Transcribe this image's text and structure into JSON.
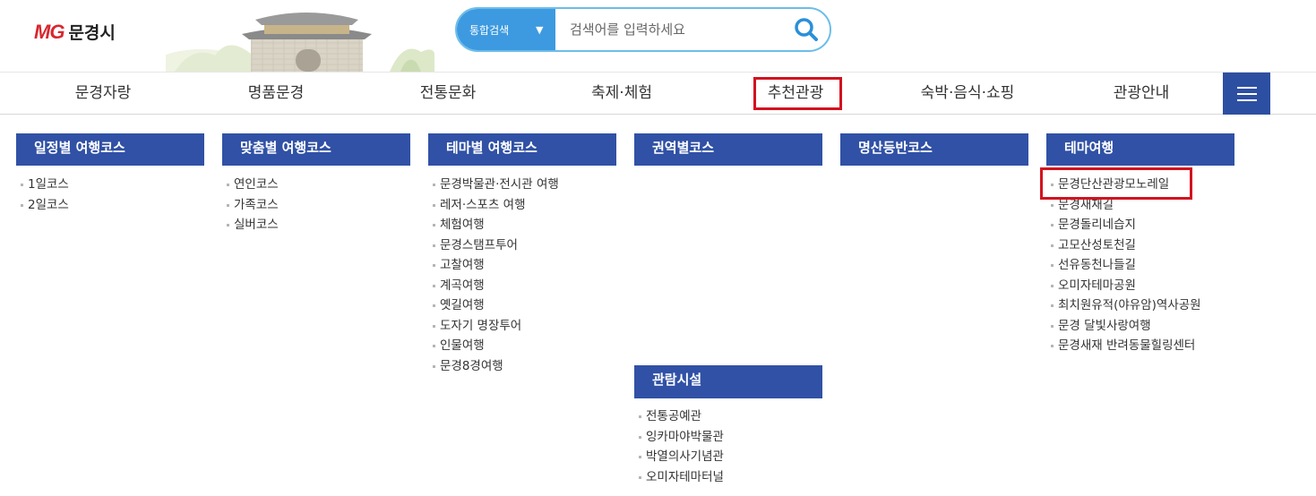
{
  "header": {
    "logo_mark": "MG",
    "logo_text": "문경시",
    "search": {
      "category": "통합검색",
      "placeholder": "검색어를 입력하세요"
    }
  },
  "gnb": {
    "items": [
      "문경자랑",
      "명품문경",
      "전통문화",
      "축제·체험",
      "추천관광",
      "숙박·음식·쇼핑",
      "관광안내"
    ],
    "active": "추천관광"
  },
  "submenu": {
    "col1": {
      "title": "일정별 여행코스",
      "items": [
        "1일코스",
        "2일코스"
      ]
    },
    "col2": {
      "title": "맞춤별 여행코스",
      "items": [
        "연인코스",
        "가족코스",
        "실버코스"
      ]
    },
    "col3": {
      "title": "테마별 여행코스",
      "items": [
        "문경박물관·전시관 여행",
        "레저·스포츠 여행",
        "체험여행",
        "문경스탬프투어",
        "고찰여행",
        "계곡여행",
        "옛길여행",
        "도자기 명장투어",
        "인물여행",
        "문경8경여행"
      ]
    },
    "col4": {
      "title": "권역별코스",
      "items": []
    },
    "col4b": {
      "title": "관람시설",
      "items": [
        "전통공예관",
        "잉카마야박물관",
        "박열의사기념관",
        "오미자테마터널"
      ]
    },
    "col5": {
      "title": "명산등반코스",
      "items": []
    },
    "col6": {
      "title": "테마여행",
      "items": [
        "문경단산관광모노레일",
        "문경새재길",
        "문경돌리네습지",
        "고모산성토천길",
        "선유동천나들길",
        "오미자테마공원",
        "최치원유적(야유암)역사공원",
        "문경 달빛사랑여행",
        "문경새재 반려동물힐링센터"
      ]
    }
  },
  "colors": {
    "accent": "#3051a5",
    "highlight": "#d3121f",
    "search": "#3d9ae0"
  }
}
